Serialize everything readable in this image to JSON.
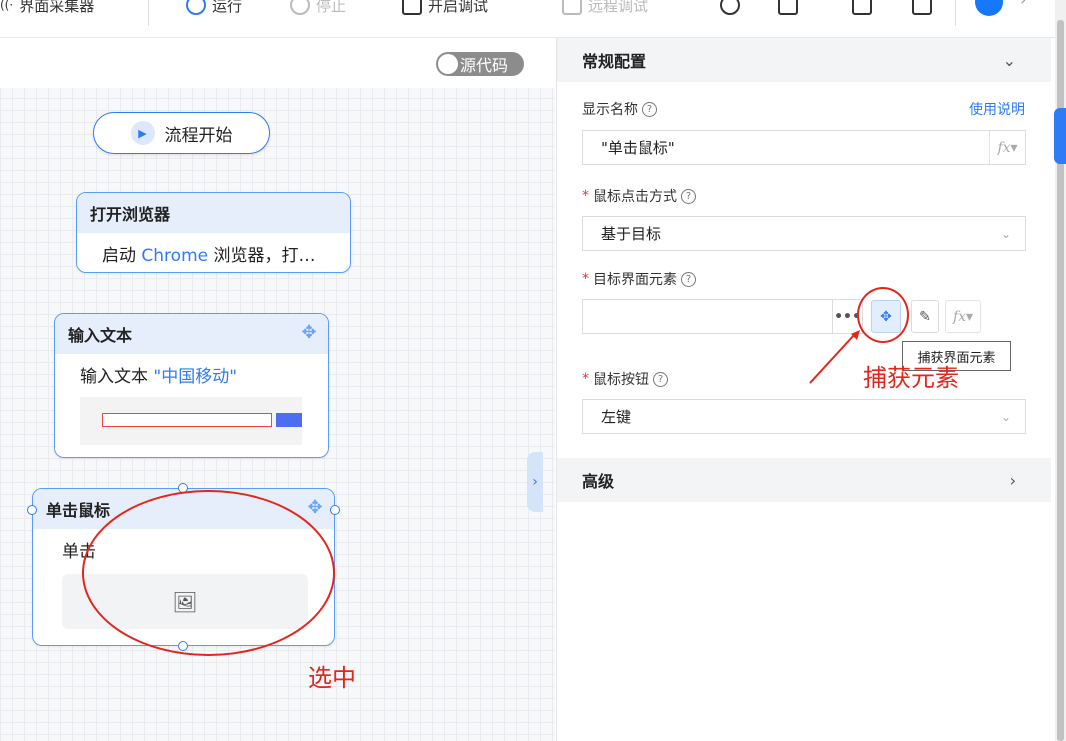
{
  "toolbar": {
    "app_label": "界面采集器",
    "run_label": "运行",
    "stop_label": "停止",
    "debug_label": "开启调试",
    "remote_debug_label": "远程调试"
  },
  "canvas": {
    "source_toggle_label": "源代码",
    "start_node_label": "流程开始",
    "nodes": [
      {
        "title": "打开浏览器",
        "body_prefix": "启动 ",
        "body_highlight": "Chrome",
        "body_suffix": " 浏览器，打…"
      },
      {
        "title": "输入文本",
        "body_prefix": "输入文本 ",
        "body_highlight": "\"中国移动\"",
        "body_suffix": ""
      },
      {
        "title": "单击鼠标",
        "body_prefix": "单击",
        "body_highlight": "",
        "body_suffix": ""
      }
    ]
  },
  "panel": {
    "general_section": "常规配置",
    "display_name_label": "显示名称",
    "help_link": "使用说明",
    "display_name_value": "\"单击鼠标\"",
    "click_mode_label": "鼠标点击方式",
    "click_mode_value": "基于目标",
    "target_label": "目标界面元素",
    "target_value": "",
    "capture_tooltip": "捕获界面元素",
    "mouse_button_label": "鼠标按钮",
    "mouse_button_value": "左键",
    "advanced_section": "高级",
    "fx_label": "fx"
  },
  "annotations": {
    "capture_note": "捕获元素",
    "select_note": "选中",
    "color": "#e3261c"
  },
  "colors": {
    "accent": "#2f7bf5",
    "node_header": "#e6eefb"
  }
}
